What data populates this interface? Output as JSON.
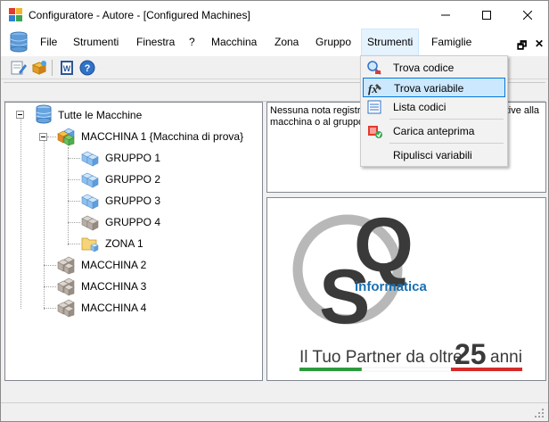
{
  "window": {
    "title": "Configuratore - Autore - [Configured Machines]"
  },
  "menubar": {
    "items": [
      {
        "label": "File"
      },
      {
        "label": "Strumenti"
      },
      {
        "label": "Finestra"
      },
      {
        "label": "?"
      },
      {
        "label": "Macchina"
      },
      {
        "label": "Zona"
      },
      {
        "label": "Gruppo"
      },
      {
        "label": "Strumenti"
      },
      {
        "label": "Famiglie"
      }
    ],
    "mdi_restore": "🗗",
    "mdi_close": "✕"
  },
  "dropdown": {
    "items": [
      {
        "label": "Trova codice",
        "icon": "find-code-icon"
      },
      {
        "label": "Trova variabile",
        "icon": "find-variable-icon"
      },
      {
        "label": "Lista codici",
        "icon": "code-list-icon"
      },
      {
        "label": "Carica anteprima",
        "icon": "load-preview-icon"
      },
      {
        "label": "Ripulisci variabili",
        "icon": ""
      }
    ],
    "highlighted_index": 1
  },
  "tree": {
    "root": "Tutte le Macchine",
    "machine1": "MACCHINA 1 {Macchina di prova}",
    "groups": [
      "GRUPPO 1",
      "GRUPPO 2",
      "GRUPPO 3",
      "GRUPPO 4"
    ],
    "zone": "ZONA 1",
    "machines": [
      "MACCHINA 2",
      "MACCHINA 3",
      "MACCHINA 4"
    ]
  },
  "notes": {
    "line1_left": "Nessuna nota registra",
    "line1_right": "tive alla",
    "line2": "macchina o al gruppo"
  },
  "logo": {
    "letter_q": "Q",
    "letter_s": "S",
    "brand": "informatica",
    "tagline": "Il Tuo Partner da oltre",
    "years": "25",
    "years_suffix": "anni",
    "colors": {
      "green": "#2e9a3e",
      "red": "#d42b2b",
      "blue": "#1a6fb0",
      "dark": "#3a3a3a"
    }
  },
  "colors": {
    "accent": "#0078d7",
    "menu_active_bg": "#e5f3ff",
    "dropdown_highlight": "#cce8ff"
  }
}
